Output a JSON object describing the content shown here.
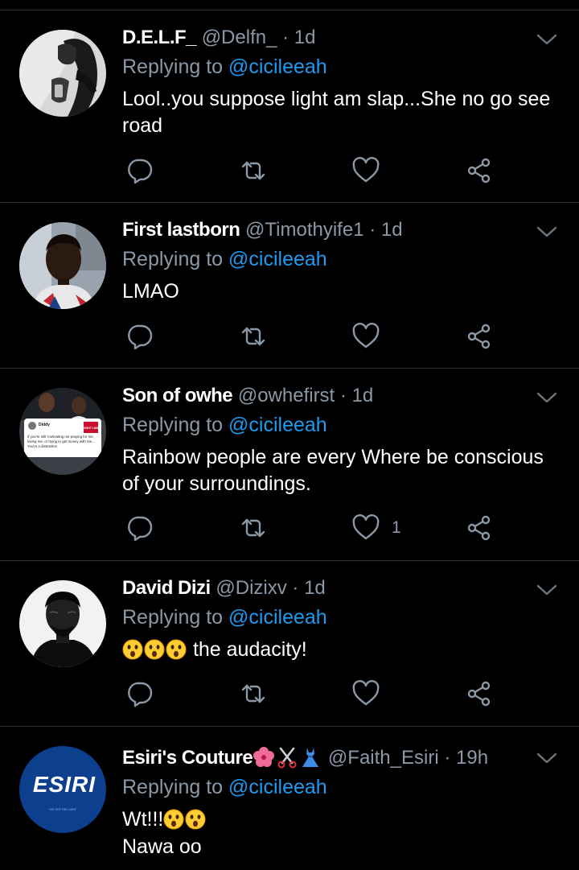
{
  "tweets": [
    {
      "name": "D.E.L.F_",
      "handle": "@Delfn_",
      "dot": "·",
      "time": "1d",
      "replying_prefix": "Replying to",
      "replying_handle": "@cicileeah",
      "text": "Lool..you suppose light am slap...She no go see road",
      "like_count": ""
    },
    {
      "name": "First lastborn",
      "handle": "@Timothyife1",
      "dot": "·",
      "time": "1d",
      "replying_prefix": "Replying to",
      "replying_handle": "@cicileeah",
      "text": "LMAO",
      "like_count": ""
    },
    {
      "name": "Son of owhe",
      "handle": "@owhefirst",
      "dot": "·",
      "time": "1d",
      "replying_prefix": "Replying to",
      "replying_handle": "@cicileeah",
      "text": "Rainbow people are every Where be conscious of your surroundings.",
      "like_count": "1",
      "avatar_tweet_text": "If you're still 'motivating me praying for me, loving me, or trying to get money with me... You're a distraction",
      "avatar_tweet_name": "Diddy",
      "avatar_tweet_badge": "RIGHT LINE"
    },
    {
      "name": "David Dizi",
      "handle": "@Dizixv",
      "dot": "·",
      "time": "1d",
      "replying_prefix": "Replying to",
      "replying_handle": "@cicileeah",
      "text": "the audacity!",
      "like_count": ""
    },
    {
      "name": "Esiri's Couture",
      "name_emojis": [
        "hibiscus-emoji",
        "scissors-emoji",
        "dress-emoji"
      ],
      "handle": "@Faith_Esiri",
      "dot": "·",
      "time": "19h",
      "replying_prefix": "Replying to",
      "replying_handle": "@cicileeah",
      "text_line1": "Wt!!!",
      "text_line2": "Nawa oo",
      "avatar_logo": "ESIRI",
      "avatar_tagline": "I'VE GOT THE LIGHT"
    }
  ],
  "colors": {
    "background": "#000000",
    "divider": "#2f3336",
    "secondary_text": "#8b98a5",
    "mention": "#1d9bf0",
    "esiri_avatar": "#0d3f8f"
  },
  "icons": [
    "reply-icon",
    "retweet-icon",
    "like-icon",
    "share-icon",
    "chevron-down-icon"
  ]
}
